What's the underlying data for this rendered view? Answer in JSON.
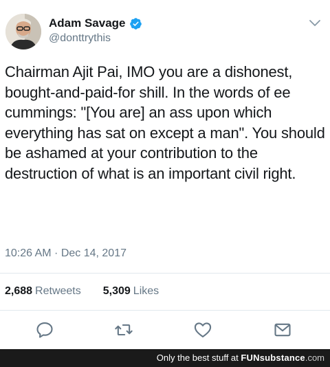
{
  "author": {
    "name": "Adam Savage",
    "handle": "@donttrythis",
    "verified": true
  },
  "tweet": {
    "text": "Chairman Ajit Pai, IMO you are a dishonest, bought-and-paid-for shill. In the words of ee cummings: \"[You are] an ass upon which everything has sat on except a man\". You should be ashamed at your contribution to the destruction of what is an important civil right.",
    "timestamp": "10:26 AM · Dec 14, 2017"
  },
  "stats": {
    "retweets_count": "2,688",
    "retweets_label": "Retweets",
    "likes_count": "5,309",
    "likes_label": "Likes"
  },
  "actions": {
    "reply_icon": "reply-icon",
    "retweet_icon": "retweet-icon",
    "like_icon": "heart-icon",
    "share_icon": "share-icon"
  },
  "watermark": {
    "prefix": "Only the best stuff at",
    "brand_main": "FUNsubstance",
    "brand_suffix": ".com"
  },
  "colors": {
    "text": "#14171a",
    "secondary": "#657786",
    "verified": "#1da1f2",
    "divider": "#e1e8ed",
    "footer_bg": "#1a1a1a"
  }
}
